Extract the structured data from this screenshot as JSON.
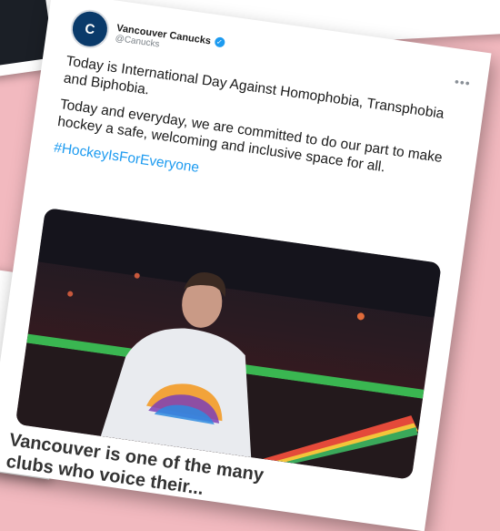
{
  "tweet": {
    "display_name": "Vancouver Canucks",
    "handle": "@Canucks",
    "paragraph1": "Today is International Day Against Homophobia, Transphobia and Biphobia.",
    "paragraph2": "Today and everyday, we are committed to do our part to make hockey a safe, welcoming and inclusive space for all.",
    "hashtag": "#HockeyIsForEveryone",
    "more_label": "•••"
  },
  "caption": {
    "line1": "Vancouver is one of the many",
    "line2": "clubs who voice their..."
  },
  "icons": {
    "avatar": "canucks-logo-icon",
    "verified": "verified-badge-icon",
    "more": "more-options-icon"
  },
  "colors": {
    "background": "#f2b9bf",
    "link": "#1d9bf0",
    "text": "#1b1b1b"
  }
}
